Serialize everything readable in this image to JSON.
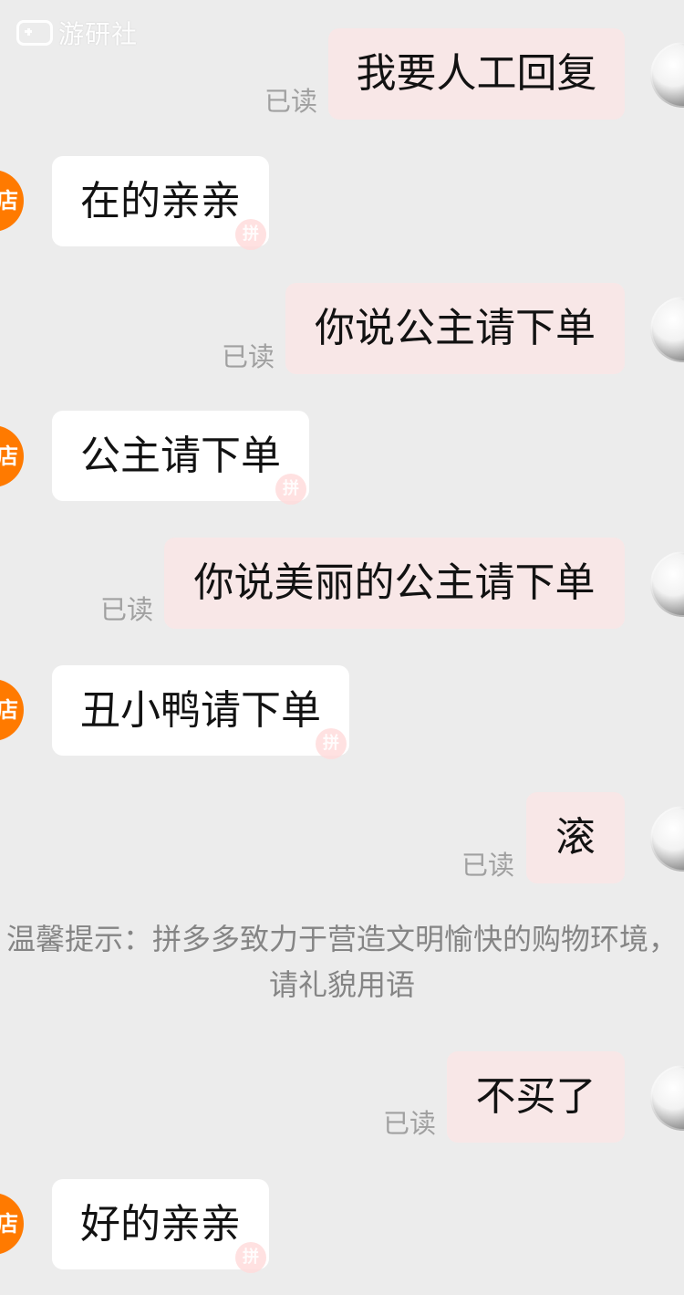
{
  "watermark": {
    "text": "游研社",
    "icon": "gamepad-icon"
  },
  "chat": {
    "read_label": "已读",
    "messages": [
      {
        "side": "right",
        "text": "我要人工回复",
        "read_label": "已读"
      },
      {
        "side": "left",
        "avatar_label": "店",
        "text": "在的亲亲"
      },
      {
        "side": "right",
        "text": "你说公主请下单",
        "read_label": "已读"
      },
      {
        "side": "left",
        "avatar_label": "店",
        "text": "公主请下单"
      },
      {
        "side": "right",
        "text": "你说美丽的公主请下单",
        "read_label": "已读"
      },
      {
        "side": "left",
        "avatar_label": "店",
        "text": "丑小鸭请下单"
      },
      {
        "side": "right",
        "text": "滚",
        "read_label": "已读"
      },
      {
        "side": "right",
        "text": "不买了",
        "read_label": "已读"
      },
      {
        "side": "left",
        "avatar_label": "店",
        "text": "好的亲亲"
      }
    ],
    "notice": "温馨提示：拼多多致力于营造文明愉快的购物环境，请礼貌用语"
  },
  "colors": {
    "background": "#ececec",
    "incoming_bubble": "#ffffff",
    "outgoing_bubble": "#f8e7e7",
    "shop_avatar": "#ff7a00",
    "read_text": "#a0a0a0",
    "notice_text": "#858585"
  }
}
